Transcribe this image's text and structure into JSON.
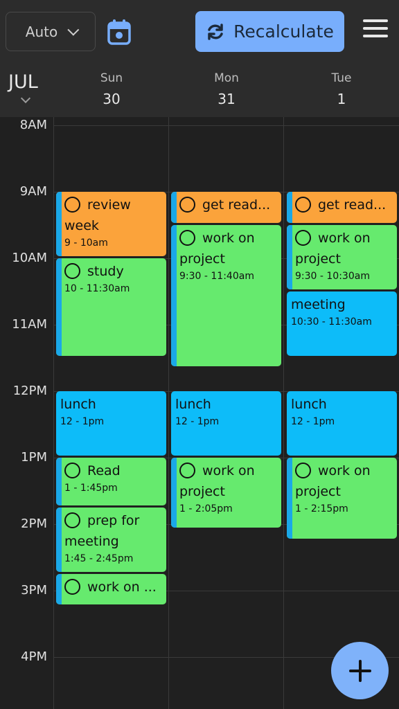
{
  "toolbar": {
    "mode": "Auto",
    "recalculate_label": "Recalculate",
    "icons": [
      "chevron-down-icon",
      "calendar-icon",
      "refresh-icon",
      "menu-icon",
      "plus-icon"
    ]
  },
  "header": {
    "month": "JUL",
    "days": [
      {
        "name": "Sun",
        "date": "30"
      },
      {
        "name": "Mon",
        "date": "31"
      },
      {
        "name": "Tue",
        "date": "1"
      }
    ]
  },
  "hours": [
    "8AM",
    "9AM",
    "10AM",
    "11AM",
    "12PM",
    "1PM",
    "2PM",
    "3PM",
    "4PM"
  ],
  "events": {
    "sun": [
      {
        "title": "review week",
        "time": "9 - 10am"
      },
      {
        "title": "study",
        "time": "10 - 11:30am"
      },
      {
        "title": "lunch",
        "time": "12 - 1pm"
      },
      {
        "title": "Read",
        "time": "1 - 1:45pm"
      },
      {
        "title": "prep for meeting",
        "time": "1:45 - 2:45pm"
      },
      {
        "title": "work on ..."
      }
    ],
    "mon": [
      {
        "title": "get read..."
      },
      {
        "title": "work on project",
        "time": "9:30 - 11:40am"
      },
      {
        "title": "lunch",
        "time": "12 - 1pm"
      },
      {
        "title": "work on project",
        "time": "1 - 2:05pm"
      }
    ],
    "tue": [
      {
        "title": "get read..."
      },
      {
        "title": "work on project",
        "time": "9:30 - 10:30am"
      },
      {
        "title": "meeting",
        "time": "10:30 - 11:30am"
      },
      {
        "title": "lunch",
        "time": "12 - 1pm"
      },
      {
        "title": "work on project",
        "time": "1 - 2:15pm"
      }
    ]
  },
  "colors": {
    "task_green": "#66ea6e",
    "task_orange": "#fba33b",
    "event_blue": "#0dbcf9",
    "accent_button": "#78aefc"
  }
}
